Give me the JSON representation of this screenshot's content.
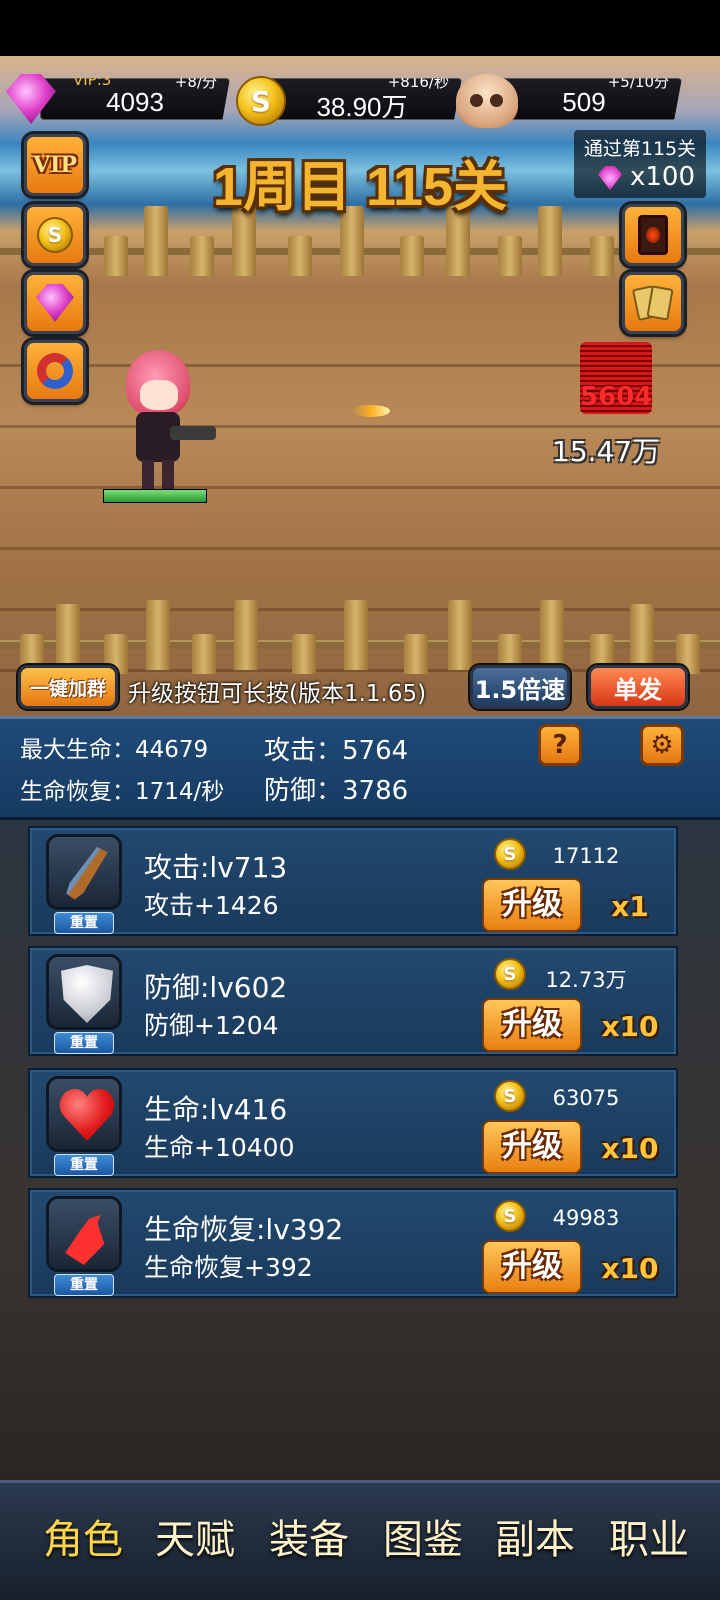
{
  "resources": {
    "vip": "VIP:3",
    "gems": {
      "value": "4093",
      "rate": "+8/分",
      "icon": "gem-icon"
    },
    "gold": {
      "value": "38.90万",
      "rate": "+816/秒",
      "icon": "coin-icon",
      "symbol": "S"
    },
    "skulls": {
      "value": "509",
      "rate": "+5/10分",
      "icon": "skull-icon"
    }
  },
  "stage": {
    "title": "1周目 115关"
  },
  "reward": {
    "text": "通过第115关",
    "amount": "x100"
  },
  "side_buttons": {
    "vip": "VIP",
    "coin_symbol": "S"
  },
  "battle": {
    "damage": "5604",
    "enemy_hp": "15.47万",
    "hero_hp_fraction": 1.0
  },
  "toolbar": {
    "join_group": "一键加群",
    "hint": "升级按钮可长按(版本1.1.65)",
    "speed": "1.5倍速",
    "fire_mode": "单发"
  },
  "stats": {
    "max_hp": "最大生命：44679",
    "attack": "攻击：5764",
    "regen": "生命恢复：1714/秒",
    "defense": "防御：3786",
    "help": "?",
    "settings": "⚙"
  },
  "upgrades": [
    {
      "icon": "knife-icon",
      "name": "攻击:lv713",
      "effect": "攻击+1426",
      "cost": "17112",
      "button": "升级",
      "mult": "x1",
      "reset": "重置"
    },
    {
      "icon": "shield-icon",
      "name": "防御:lv602",
      "effect": "防御+1204",
      "cost": "12.73万",
      "button": "升级",
      "mult": "x10",
      "reset": "重置"
    },
    {
      "icon": "heart-icon",
      "name": "生命:lv416",
      "effect": "生命+10400",
      "cost": "63075",
      "button": "升级",
      "mult": "x10",
      "reset": "重置"
    },
    {
      "icon": "potion-icon",
      "name": "生命恢复:lv392",
      "effect": "生命恢复+392",
      "cost": "49983",
      "button": "升级",
      "mult": "x10",
      "reset": "重置"
    }
  ],
  "nav": [
    "角色",
    "天赋",
    "装备",
    "图鉴",
    "副本",
    "职业"
  ],
  "colors": {
    "accent": "#f4b531",
    "panel": "#1f4a78",
    "button": "#e88010"
  }
}
